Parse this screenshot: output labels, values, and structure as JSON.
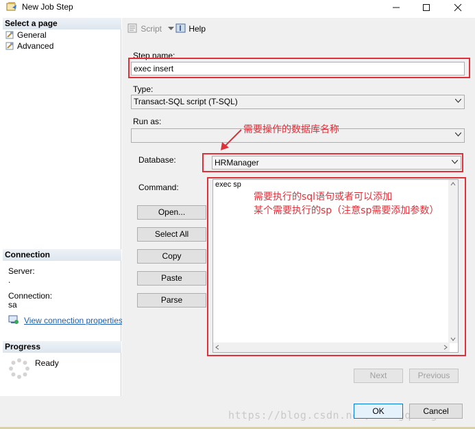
{
  "window": {
    "title": "New Job Step"
  },
  "left_pane": {
    "select_page_header": "Select a page",
    "pages": [
      {
        "label": "General"
      },
      {
        "label": "Advanced"
      }
    ],
    "connection_header": "Connection",
    "server_label": "Server:",
    "server_value": ".",
    "connection_label": "Connection:",
    "connection_value": "sa",
    "view_connection_link": "View connection properties",
    "progress_header": "Progress",
    "progress_status": "Ready"
  },
  "toolbar": {
    "script_label": "Script",
    "help_label": "Help"
  },
  "form": {
    "step_name_label": "Step name:",
    "step_name_value": "exec insert",
    "type_label": "Type:",
    "type_value": "Transact-SQL script (T-SQL)",
    "run_as_label": "Run as:",
    "run_as_value": "",
    "database_label": "Database:",
    "database_value": "HRManager",
    "command_label": "Command:",
    "command_text": "exec sp"
  },
  "command_buttons": {
    "open": "Open...",
    "select_all": "Select All",
    "copy": "Copy",
    "paste": "Paste",
    "parse": "Parse"
  },
  "nav_buttons": {
    "next": "Next",
    "previous": "Previous"
  },
  "dialog_buttons": {
    "ok": "OK",
    "cancel": "Cancel"
  },
  "annotations": {
    "database_note": "需要操作的数据库名称",
    "command_note_line1": "需要执行的sql语句或者可以添加",
    "command_note_line2": "某个需要执行的sp（注意sp需要添加参数）"
  },
  "watermark": "https://blog.csdn.net/zhangqiong0520",
  "colors": {
    "annotation_red": "#e0313a",
    "link_blue": "#1a5fb4",
    "header_bg": "#dde5ee"
  }
}
